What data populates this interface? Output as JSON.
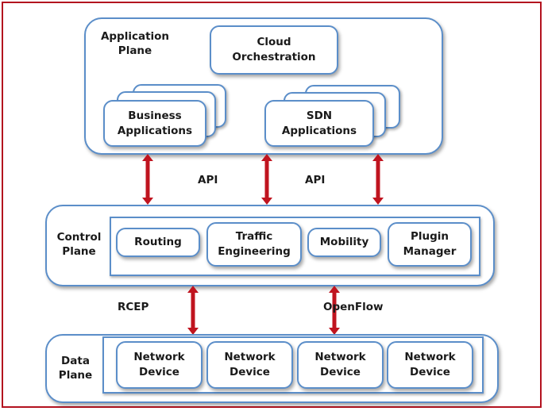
{
  "diagram": {
    "application_plane": {
      "label_line1": "Application",
      "label_line2": "Plane",
      "cloud": {
        "line1": "Cloud",
        "line2": "Orchestration"
      },
      "business": {
        "line1": "Business",
        "line2": "Applications"
      },
      "sdn": {
        "line1": "SDN",
        "line2": "Applications"
      }
    },
    "interfaces": {
      "north_left": "API",
      "north_right": "API",
      "south_left": "RCEP",
      "south_right": "OpenFlow"
    },
    "control_plane": {
      "label_line1": "Control",
      "label_line2": "Plane",
      "modules": [
        {
          "line1": "Routing",
          "line2": ""
        },
        {
          "line1": "Traffic",
          "line2": "Engineering"
        },
        {
          "line1": "Mobility",
          "line2": ""
        },
        {
          "line1": "Plugin",
          "line2": "Manager"
        }
      ]
    },
    "data_plane": {
      "label_line1": "Data",
      "label_line2": "Plane",
      "devices": [
        {
          "line1": "Network",
          "line2": "Device"
        },
        {
          "line1": "Network",
          "line2": "Device"
        },
        {
          "line1": "Network",
          "line2": "Device"
        },
        {
          "line1": "Network",
          "line2": "Device"
        }
      ]
    },
    "colors": {
      "frame": "#b3121f",
      "box_border": "#5b8ec9",
      "arrow": "#c0141f"
    }
  }
}
